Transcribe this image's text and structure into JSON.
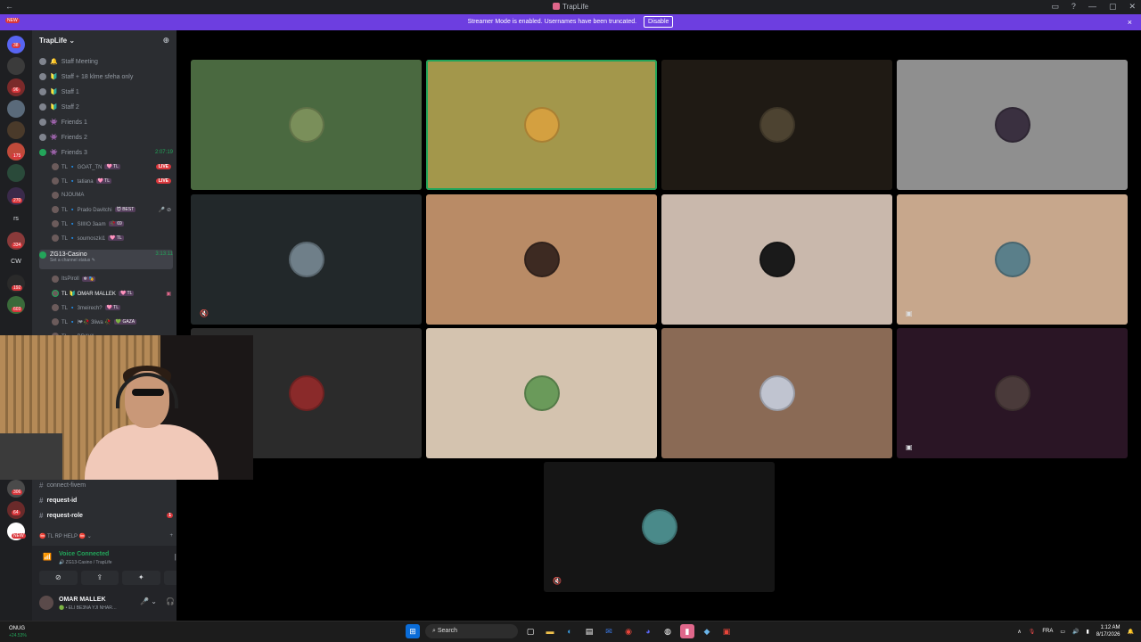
{
  "titlebar": {
    "title": "TrapLife",
    "back": "←"
  },
  "banner": {
    "text": "Streamer Mode is enabled. Usernames have been truncated.",
    "disable_label": "Disable",
    "close": "×"
  },
  "guilds": {
    "badges": [
      "NEW",
      "38",
      "96",
      "175",
      "270",
      "334",
      "192",
      "603",
      "NEW",
      "306",
      "64"
    ],
    "texts": [
      "rs",
      "CW"
    ]
  },
  "server": {
    "name": "TrapLife ⌄"
  },
  "voice_channels": [
    {
      "name": "Staff Meeting",
      "emoji": "🔔"
    },
    {
      "name": "Staff + 18 klme sfeha only",
      "emoji": "🔰"
    },
    {
      "name": "Staff 1",
      "emoji": "🔰"
    },
    {
      "name": "Staff 2",
      "emoji": "🔰"
    },
    {
      "name": "Friends 1",
      "emoji": "👾"
    },
    {
      "name": "Friends 2",
      "emoji": "👾"
    },
    {
      "name": "Friends 3",
      "emoji": "👾",
      "timer": "2:07:19"
    }
  ],
  "friends3_members": [
    {
      "name": "TL 🔹 GOAT_TN",
      "tag": "🩷 TL",
      "live": "LIVE"
    },
    {
      "name": "TL 🔹 tatiana",
      "tag": "🩷 TL",
      "live": "LIVE"
    },
    {
      "name": "NJOUMA",
      "tag": "",
      "badge": ""
    },
    {
      "name": "TL 🔹 Prado Davitchi",
      "tag": "😈 BEST",
      "badge": "🎤 ⊘"
    },
    {
      "name": "TL 🔹 SIIIIO 3aam",
      "tag": "🥀 69",
      "badge": ""
    },
    {
      "name": "TL 🔹 soumoszki1",
      "tag": "🩷 TL",
      "badge": ""
    }
  ],
  "active_channel": {
    "name": "ZG13-Casino",
    "sub": "Set a channel status ✎",
    "timer": "3:13:11"
  },
  "casino_members": [
    {
      "name": "ItsPiroll",
      "tag": "❄ 🎭"
    },
    {
      "name": "TL 🔰 OMAR MALLEK",
      "tag": "🩷 TL",
      "badge": "▣"
    },
    {
      "name": "TL 🔹 3meirech?",
      "tag": "🩷 TL"
    },
    {
      "name": "TL 🔹 l❤🥀 3liwa 🥀",
      "tag": "💚 GAZA"
    },
    {
      "name": "TL 🔹 BRAVA",
      "tag": ""
    }
  ],
  "text_channels": [
    {
      "name": "connect-fivem",
      "bold": false
    },
    {
      "name": "request-id",
      "bold": true
    },
    {
      "name": "request-role",
      "bold": true,
      "mention": "1"
    }
  ],
  "category": {
    "name": "⛔ TL RP HELP ⛔ ⌄",
    "add": "+"
  },
  "voice_panel": {
    "status": "Voice Connected",
    "sub": "🔊 ZG13-Casino / TrapLife",
    "buttons": [
      "⊘",
      "⇪",
      "✦",
      "✎"
    ],
    "user_name": "OMAR MALLEK",
    "user_status": "🟢 • ELI BE3NA YJI NHAR…",
    "controls": [
      "🎤 ⌄",
      "🎧 ⌄",
      "⚙"
    ]
  },
  "tiles": [
    {
      "color": "#4a6940",
      "avatar": "#7a8f5a",
      "icon": ""
    },
    {
      "color": "#a3974b",
      "avatar": "#d4a040",
      "icon": "",
      "speaking": true
    },
    {
      "color": "#1f1a14",
      "avatar": "#4d4331",
      "icon": ""
    },
    {
      "color": "#8f8f8f",
      "avatar": "#3a3040",
      "icon": ""
    },
    {
      "color": "#22282a",
      "avatar": "#6f7f89",
      "icon": "🔇"
    },
    {
      "color": "#b98b66",
      "avatar": "#3d2a22",
      "icon": ""
    },
    {
      "color": "#c9b8ac",
      "avatar": "#1a1a1a",
      "icon": ""
    },
    {
      "color": "#c7a78c",
      "avatar": "#5a7f8a",
      "icon": "▣"
    },
    {
      "color": "#2b2b2b",
      "avatar": "#8a2a2a",
      "icon": ""
    },
    {
      "color": "#d4c3af",
      "avatar": "#6a9a5a",
      "icon": ""
    },
    {
      "color": "#8a6a55",
      "avatar": "#c0c4d0",
      "icon": ""
    },
    {
      "color": "#2a1525",
      "avatar": "#4a3a3a",
      "icon": "▣"
    },
    {
      "color": "#151515",
      "avatar": "#4a8a8a",
      "icon": "🔇"
    }
  ],
  "taskbar": {
    "weather_label": "ONUG",
    "weather_change": "+24.53%",
    "search": "Search",
    "lang": "FRA",
    "time": "1:12 AM",
    "date": "8/17/2026"
  }
}
